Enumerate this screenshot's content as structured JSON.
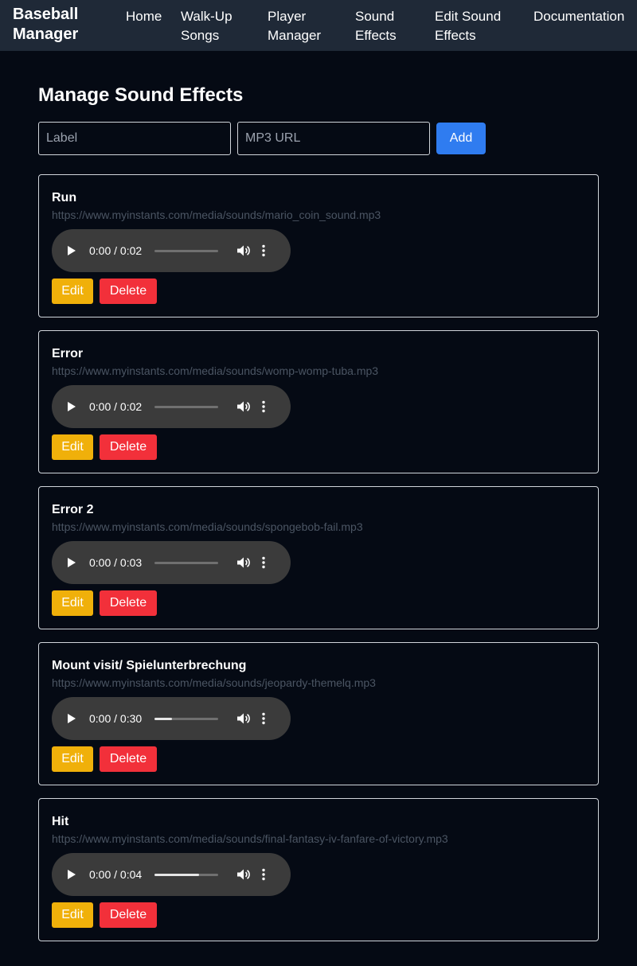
{
  "nav": {
    "brand": "Baseball\nManager",
    "links": [
      {
        "label": "Home"
      },
      {
        "label": "Walk-Up\nSongs"
      },
      {
        "label": "Player\nManager"
      },
      {
        "label": "Sound\nEffects"
      },
      {
        "label": "Edit Sound\nEffects"
      },
      {
        "label": "Documentation"
      }
    ]
  },
  "page": {
    "title": "Manage Sound Effects",
    "label_placeholder": "Label",
    "url_placeholder": "MP3 URL",
    "add_label": "Add"
  },
  "colors": {
    "nav_bg": "#1f2937",
    "page_bg": "#050a14",
    "add": "#2f7cf0",
    "edit": "#f0b00a",
    "delete": "#f2303a"
  },
  "sounds": [
    {
      "label": "Run",
      "url": "https://www.myinstants.com/media/sounds/mario_coin_sound.mp3",
      "time": "0:00 / 0:02",
      "progress": 0
    },
    {
      "label": "Error",
      "url": "https://www.myinstants.com/media/sounds/womp-womp-tuba.mp3",
      "time": "0:00 / 0:02",
      "progress": 0
    },
    {
      "label": "Error 2",
      "url": "https://www.myinstants.com/media/sounds/spongebob-fail.mp3",
      "time": "0:00 / 0:03",
      "progress": 0
    },
    {
      "label": "Mount visit/ Spielunterbrechung",
      "url": "https://www.myinstants.com/media/sounds/jeopardy-themelq.mp3",
      "time": "0:00 / 0:30",
      "progress": 0.27
    },
    {
      "label": "Hit",
      "url": "https://www.myinstants.com/media/sounds/final-fantasy-iv-fanfare-of-victory.mp3",
      "time": "0:00 / 0:04",
      "progress": 0.7
    }
  ],
  "buttons": {
    "edit": "Edit",
    "delete": "Delete"
  }
}
